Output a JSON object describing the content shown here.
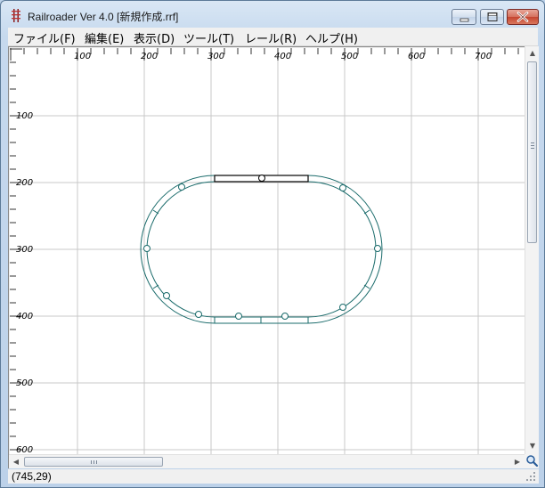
{
  "window": {
    "title": "Railroader Ver 4.0  [新規作成.rrf]"
  },
  "menu": [
    {
      "label": "ファイル(F)"
    },
    {
      "label": "編集(E)"
    },
    {
      "label": "表示(D)"
    },
    {
      "label": "ツール(T)"
    },
    {
      "label": "レール(R)"
    },
    {
      "label": "ヘルプ(H)"
    }
  ],
  "ruler": {
    "x_labels": [
      "100",
      "200",
      "300",
      "400",
      "500",
      "600",
      "700"
    ],
    "y_labels": [
      "100",
      "200",
      "300",
      "400",
      "500",
      "600"
    ]
  },
  "layout": {
    "track_color": "#1a6b6b",
    "selected_rail_color": "#000000",
    "grid_color": "#c9c9c9"
  },
  "status": {
    "coords": "(745,29)"
  },
  "icons": {
    "app": "rail-track-icon",
    "zoom": "magnifier-icon"
  }
}
